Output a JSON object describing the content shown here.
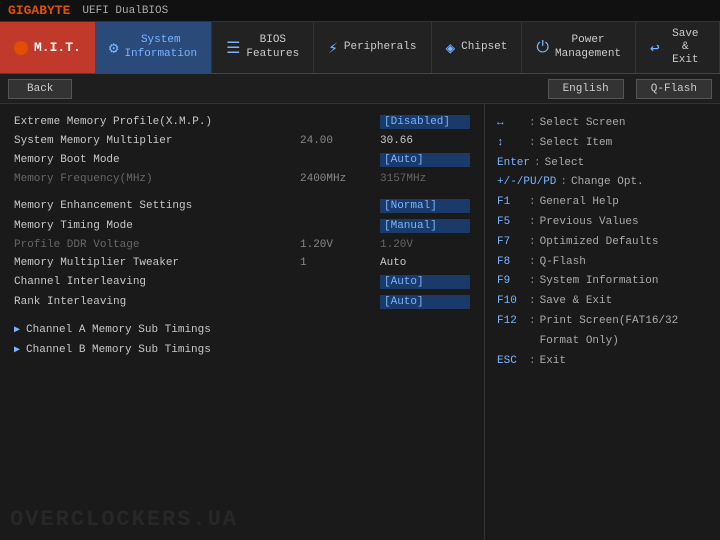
{
  "topbar": {
    "brand": "GIGABYTE",
    "dualbios": "UEFI DualBIOS"
  },
  "navbar": {
    "mit_label": "M.I.T.",
    "items": [
      {
        "id": "system-information",
        "icon": "⚙",
        "label": "System\nInformation",
        "active": true
      },
      {
        "id": "bios-features",
        "icon": "☰",
        "label": "BIOS\nFeatures",
        "active": false
      },
      {
        "id": "peripherals",
        "icon": "⚡",
        "label": "Peripherals",
        "active": false
      },
      {
        "id": "chipset",
        "icon": "◈",
        "label": "Chipset",
        "active": false
      },
      {
        "id": "power-management",
        "icon": "⏻",
        "label": "Power\nManagement",
        "active": false
      },
      {
        "id": "save-exit",
        "icon": "↩",
        "label": "Save & Exit",
        "active": false
      }
    ]
  },
  "actionbar": {
    "back_label": "Back",
    "lang_label": "English",
    "qflash_label": "Q-Flash"
  },
  "settings": {
    "rows": [
      {
        "label": "Extreme Memory Profile(X.M.P.)",
        "val_left": "",
        "val_right": "[Disabled]",
        "highlight": true,
        "dimmed": false
      },
      {
        "label": "System Memory Multiplier",
        "val_left": "24.00",
        "val_right": "30.66",
        "highlight": false,
        "dimmed": false
      },
      {
        "label": "Memory Boot Mode",
        "val_left": "",
        "val_right": "[Auto]",
        "highlight": true,
        "dimmed": false
      },
      {
        "label": "Memory Frequency(MHz)",
        "val_left": "2400MHz",
        "val_right": "3157MHz",
        "highlight": false,
        "dimmed": true
      }
    ],
    "rows2": [
      {
        "label": "Memory Enhancement Settings",
        "val_left": "",
        "val_right": "[Normal]",
        "highlight": true,
        "dimmed": false
      },
      {
        "label": "Memory Timing Mode",
        "val_left": "",
        "val_right": "[Manual]",
        "highlight": true,
        "dimmed": false
      },
      {
        "label": "Profile DDR Voltage",
        "val_left": "1.20V",
        "val_right": "1.20V",
        "highlight": false,
        "dimmed": true
      },
      {
        "label": "Memory Multiplier Tweaker",
        "val_left": "1",
        "val_right": "Auto",
        "highlight": false,
        "dimmed": false
      },
      {
        "label": "Channel Interleaving",
        "val_left": "",
        "val_right": "[Auto]",
        "highlight": true,
        "dimmed": false
      },
      {
        "label": "Rank Interleaving",
        "val_left": "",
        "val_right": "[Auto]",
        "highlight": true,
        "dimmed": false
      }
    ],
    "expandable": [
      {
        "label": "Channel A Memory Sub Timings"
      },
      {
        "label": "Channel B Memory Sub Timings"
      }
    ]
  },
  "help": {
    "lines": [
      {
        "key": "↔",
        "sep": ":",
        "text": "Select Screen"
      },
      {
        "key": "↕",
        "sep": ":",
        "text": "Select Item"
      },
      {
        "key": "Enter",
        "sep": ":",
        "text": "Select"
      },
      {
        "key": "+/-/PU/PD",
        "sep": ":",
        "text": "Change Opt."
      },
      {
        "key": "F1",
        "sep": ":",
        "text": "General Help"
      },
      {
        "key": "F5",
        "sep": ":",
        "text": "Previous Values"
      },
      {
        "key": "F7",
        "sep": ":",
        "text": "Optimized Defaults"
      },
      {
        "key": "F8",
        "sep": ":",
        "text": "Q-Flash"
      },
      {
        "key": "F9",
        "sep": ":",
        "text": "System Information"
      },
      {
        "key": "F10",
        "sep": ":",
        "text": "Save & Exit"
      },
      {
        "key": "F12",
        "sep": ":",
        "text": "Print Screen(FAT16/32 Format Only)"
      },
      {
        "key": "ESC",
        "sep": ":",
        "text": "Exit"
      }
    ]
  },
  "watermark": "OVERCLOCKERS.UA"
}
